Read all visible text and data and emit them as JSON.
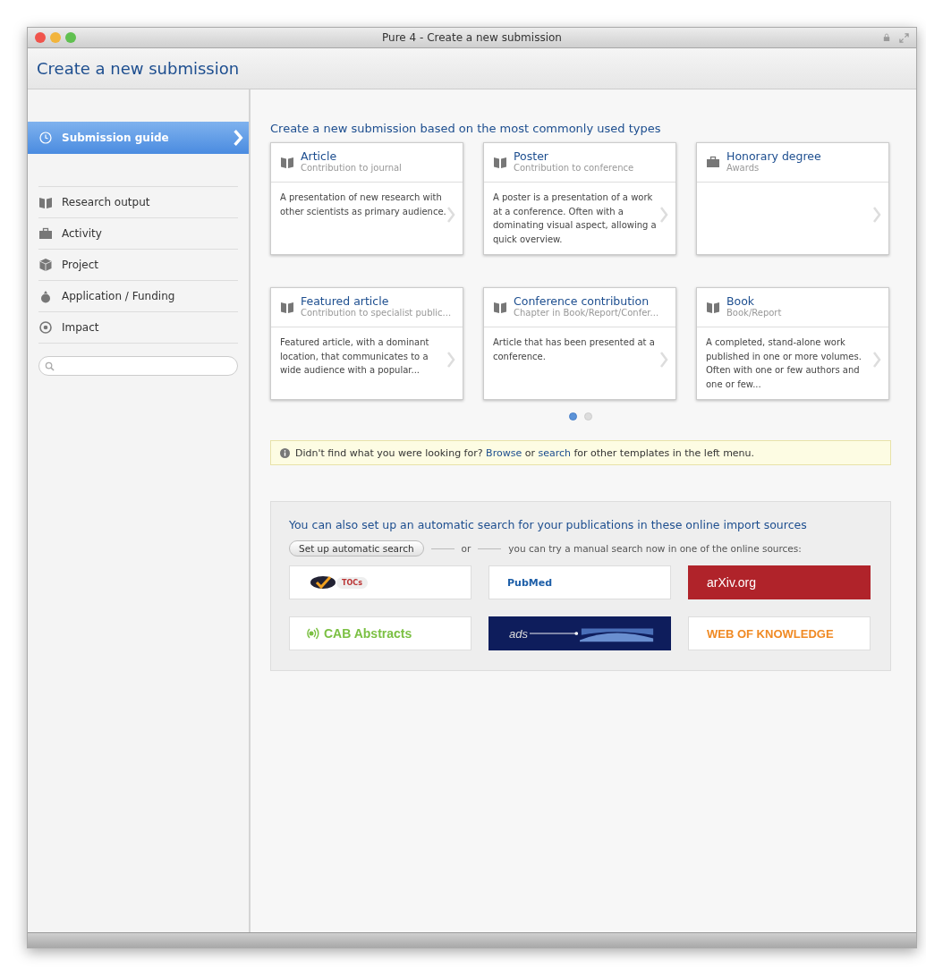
{
  "window": {
    "title": "Pure 4 - Create a new submission"
  },
  "header": {
    "title": "Create a new submission"
  },
  "sidebar": {
    "items": [
      {
        "label": "Submission guide",
        "kind": "clock",
        "selected": true
      },
      {
        "label": "Research output",
        "kind": "book",
        "selected": false
      },
      {
        "label": "Activity",
        "kind": "briefcase",
        "selected": false
      },
      {
        "label": "Project",
        "kind": "cube",
        "selected": false
      },
      {
        "label": "Application / Funding",
        "kind": "bag",
        "selected": false
      },
      {
        "label": "Impact",
        "kind": "target",
        "selected": false
      }
    ]
  },
  "main": {
    "heading": "Create a new submission based on the most commonly used types",
    "cards": [
      {
        "kind": "book",
        "title": "Article",
        "subtitle": "Contribution to journal",
        "description": "A presentation of new research with other scientists as primary audience."
      },
      {
        "kind": "book",
        "title": "Poster",
        "subtitle": "Contribution to conference",
        "description": "A poster is a presentation of a work at a conference. Often with a dominating visual aspect, allowing a quick overview."
      },
      {
        "kind": "briefcase",
        "title": "Honorary degree",
        "subtitle": "Awards"
      },
      {
        "kind": "book",
        "title": "Featured article",
        "subtitle": "Contribution to specialist public...",
        "description": "Featured article, with a dominant location, that communicates to a wide audience with a popular..."
      },
      {
        "kind": "book",
        "title": "Conference contribution",
        "subtitle": "Chapter in Book/Report/Confer...",
        "description": "Article that has been presented at a conference."
      },
      {
        "kind": "book",
        "title": "Book",
        "subtitle": "Book/Report",
        "description": "A completed, stand-alone work published in one or more volumes. Often with one or few authors and one or few..."
      }
    ],
    "pager": [
      {
        "selected": true
      },
      {
        "selected": false
      }
    ],
    "notice": {
      "text": "Didn't find what you were looking for?",
      "link1": "Browse",
      "middle": "or",
      "link2": "search",
      "end": "for other templates in the left menu."
    },
    "import": {
      "heading": "You can also set up an automatic search for your publications in these online import sources",
      "button": "Set up automatic search",
      "or": "or",
      "hint": "you can try a manual search now in one of the online sources:",
      "sources": [
        {
          "kind": "tocs",
          "label": "TOCs"
        },
        {
          "kind": "pubmed",
          "label": "PubMed"
        },
        {
          "kind": "arxiv",
          "label": "arXiv.org"
        },
        {
          "kind": "cab",
          "label": "CAB Abstracts"
        },
        {
          "kind": "nasa",
          "label": "ads"
        },
        {
          "kind": "wok",
          "label": "WEB OF KNOWLEDGE"
        }
      ]
    }
  }
}
